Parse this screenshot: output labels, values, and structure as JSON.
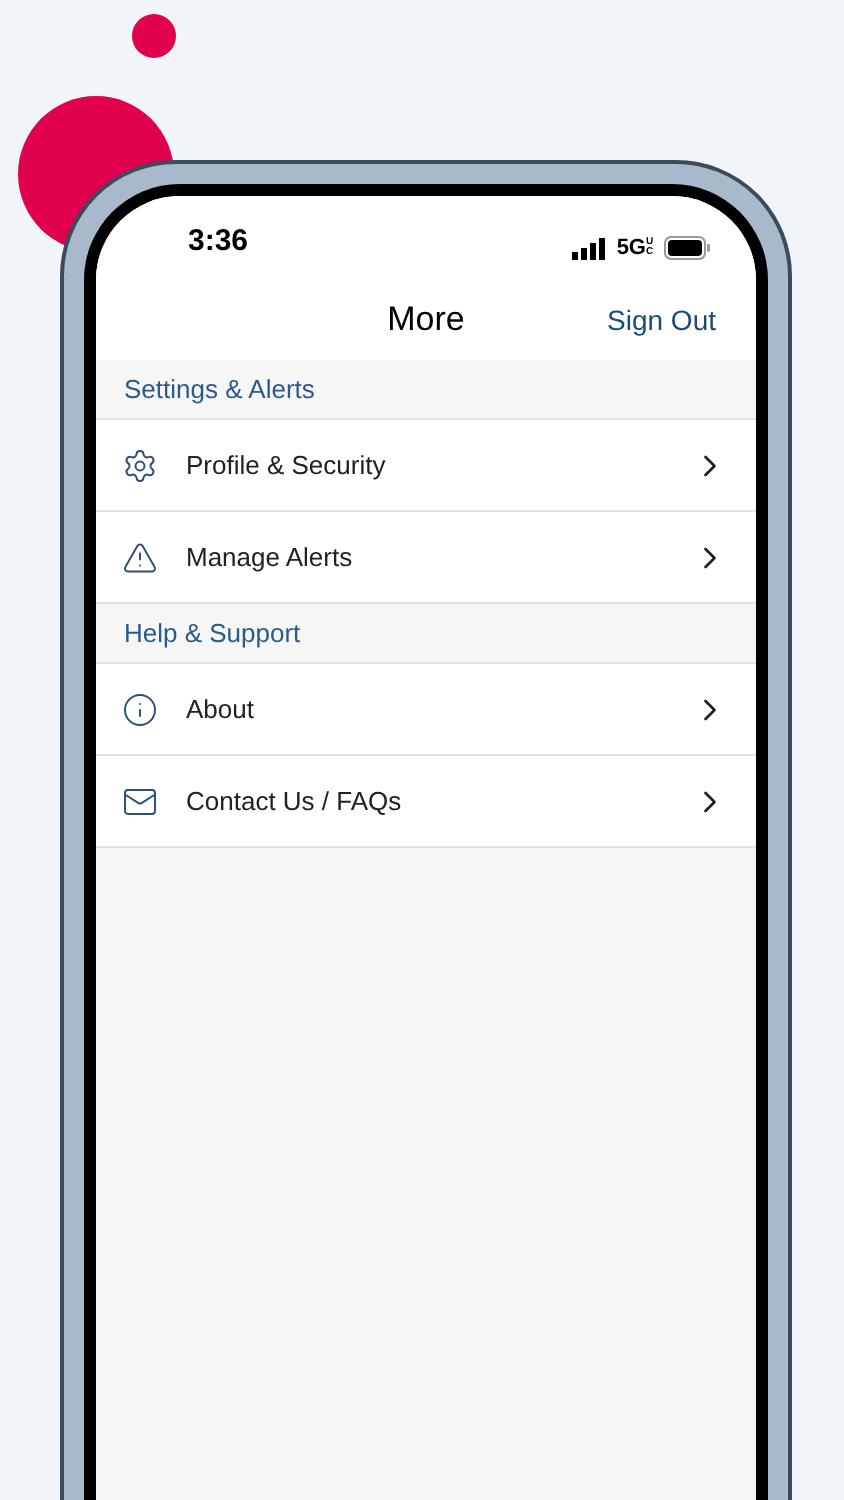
{
  "status_bar": {
    "time": "3:36",
    "network": "5G",
    "network_badge": "UC"
  },
  "header": {
    "title": "More",
    "action": "Sign Out"
  },
  "sections": [
    {
      "title": "Settings & Alerts",
      "items": [
        {
          "label": "Profile & Security"
        },
        {
          "label": "Manage Alerts"
        }
      ]
    },
    {
      "title": "Help & Support",
      "items": [
        {
          "label": "About"
        },
        {
          "label": "Contact Us / FAQs"
        }
      ]
    }
  ]
}
